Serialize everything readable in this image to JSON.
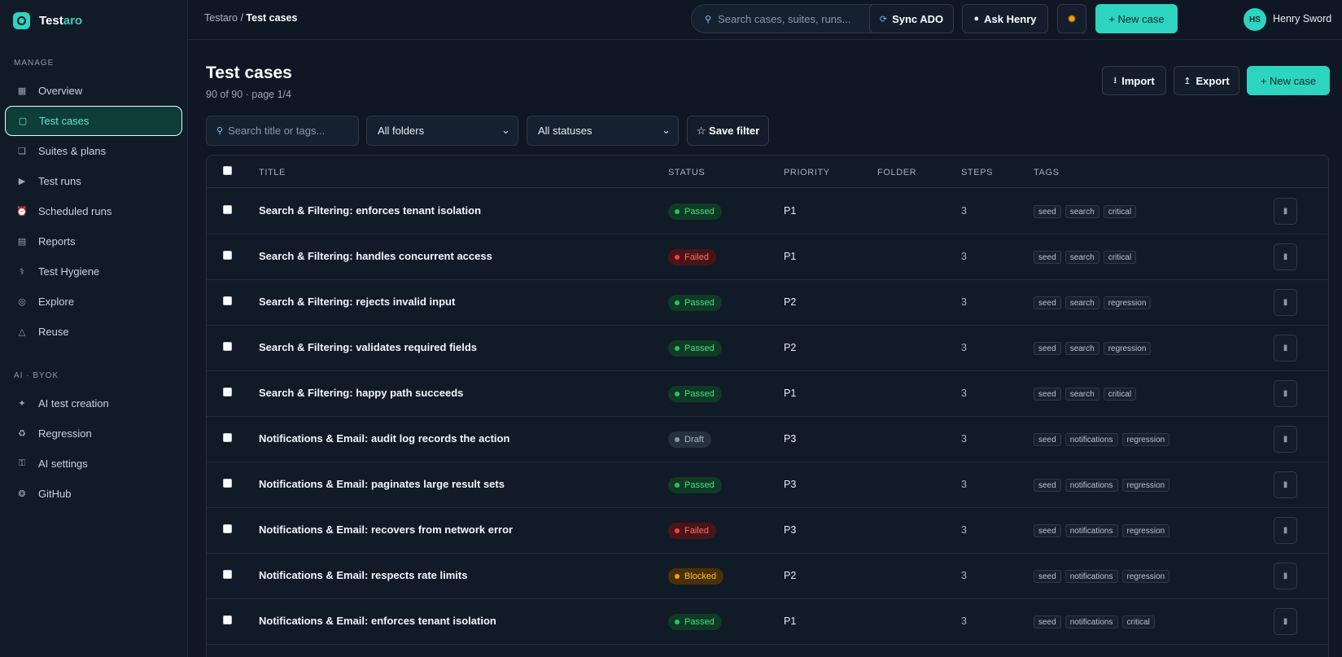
{
  "brand": {
    "name_prefix": "Test",
    "name_accent": "aro",
    "logo_icon": "target-logo-icon"
  },
  "sidebar": {
    "sections": [
      {
        "title": "MANAGE",
        "items": [
          {
            "label": "Overview",
            "icon": "grid-icon",
            "glyph": "▦",
            "active": false
          },
          {
            "label": "Test cases",
            "icon": "square-icon",
            "glyph": "▢",
            "active": true
          },
          {
            "label": "Suites & plans",
            "icon": "stack-icon",
            "glyph": "❏",
            "active": false
          },
          {
            "label": "Test runs",
            "icon": "play-icon",
            "glyph": "▶",
            "active": false
          },
          {
            "label": "Scheduled runs",
            "icon": "alarm-clock-icon",
            "glyph": "⏰",
            "active": false
          },
          {
            "label": "Reports",
            "icon": "list-icon",
            "glyph": "▤",
            "active": false
          },
          {
            "label": "Test Hygiene",
            "icon": "stethoscope-icon",
            "glyph": "⚕",
            "active": false
          },
          {
            "label": "Explore",
            "icon": "compass-icon",
            "glyph": "◎",
            "active": false
          },
          {
            "label": "Reuse",
            "icon": "triangle-icon",
            "glyph": "△",
            "active": false
          }
        ]
      },
      {
        "title": "AI · BYOK",
        "items": [
          {
            "label": "AI test creation",
            "icon": "sparkle-icon",
            "glyph": "✦",
            "active": false
          },
          {
            "label": "Regression",
            "icon": "recycle-icon",
            "glyph": "♻",
            "active": false
          },
          {
            "label": "AI settings",
            "icon": "key-icon",
            "glyph": "⚿",
            "active": false
          },
          {
            "label": "GitHub",
            "icon": "octopus-icon",
            "glyph": "❂",
            "active": false
          }
        ]
      }
    ]
  },
  "topbar": {
    "breadcrumb_root": "Testaro /",
    "breadcrumb_current": "Test cases",
    "search_placeholder": "Search cases, suites, runs...",
    "sync_label": "Sync ADO",
    "ask_label": "Ask Henry",
    "theme_icon": "sun-icon",
    "new_case_label": "+ New case",
    "user_initials": "HS",
    "user_name": "Henry Sword"
  },
  "page": {
    "title": "Test cases",
    "subtitle": "90 of 90 · page 1/4",
    "import_label": "Import",
    "export_label": "Export",
    "new_case_label": "+ New case"
  },
  "filters": {
    "search_placeholder": "Search title or tags...",
    "folder_value": "All folders",
    "status_value": "All statuses",
    "save_filter_label": "☆ Save filter"
  },
  "table": {
    "columns": [
      "TITLE",
      "STATUS",
      "PRIORITY",
      "FOLDER",
      "STEPS",
      "TAGS"
    ],
    "rows": [
      {
        "title": "Search & Filtering: enforces tenant isolation",
        "status": "Passed",
        "priority": "P1",
        "folder": "",
        "steps": "3",
        "tags": [
          "seed",
          "search",
          "critical"
        ]
      },
      {
        "title": "Search & Filtering: handles concurrent access",
        "status": "Failed",
        "priority": "P1",
        "folder": "",
        "steps": "3",
        "tags": [
          "seed",
          "search",
          "critical"
        ]
      },
      {
        "title": "Search & Filtering: rejects invalid input",
        "status": "Passed",
        "priority": "P2",
        "folder": "",
        "steps": "3",
        "tags": [
          "seed",
          "search",
          "regression"
        ]
      },
      {
        "title": "Search & Filtering: validates required fields",
        "status": "Passed",
        "priority": "P2",
        "folder": "",
        "steps": "3",
        "tags": [
          "seed",
          "search",
          "regression"
        ]
      },
      {
        "title": "Search & Filtering: happy path succeeds",
        "status": "Passed",
        "priority": "P1",
        "folder": "",
        "steps": "3",
        "tags": [
          "seed",
          "search",
          "critical"
        ]
      },
      {
        "title": "Notifications & Email: audit log records the action",
        "status": "Draft",
        "priority": "P3",
        "folder": "",
        "steps": "3",
        "tags": [
          "seed",
          "notifications",
          "regression"
        ]
      },
      {
        "title": "Notifications & Email: paginates large result sets",
        "status": "Passed",
        "priority": "P3",
        "folder": "",
        "steps": "3",
        "tags": [
          "seed",
          "notifications",
          "regression"
        ]
      },
      {
        "title": "Notifications & Email: recovers from network error",
        "status": "Failed",
        "priority": "P3",
        "folder": "",
        "steps": "3",
        "tags": [
          "seed",
          "notifications",
          "regression"
        ]
      },
      {
        "title": "Notifications & Email: respects rate limits",
        "status": "Blocked",
        "priority": "P2",
        "folder": "",
        "steps": "3",
        "tags": [
          "seed",
          "notifications",
          "regression"
        ]
      },
      {
        "title": "Notifications & Email: enforces tenant isolation",
        "status": "Passed",
        "priority": "P1",
        "folder": "",
        "steps": "3",
        "tags": [
          "seed",
          "notifications",
          "critical"
        ]
      }
    ]
  },
  "colors": {
    "accent": "#2dd4bf",
    "background": "#0f1724",
    "status": {
      "Passed": {
        "bg": "#0f3a26",
        "fg": "#4ade80",
        "dot": "#22c55e"
      },
      "Failed": {
        "bg": "#4a1417",
        "fg": "#f87171",
        "dot": "#ef4444"
      },
      "Draft": {
        "bg": "#263140",
        "fg": "#aab6c4",
        "dot": "#8b99aa"
      },
      "Blocked": {
        "bg": "#4a3006",
        "fg": "#fbbf24",
        "dot": "#f59e0b"
      }
    }
  }
}
